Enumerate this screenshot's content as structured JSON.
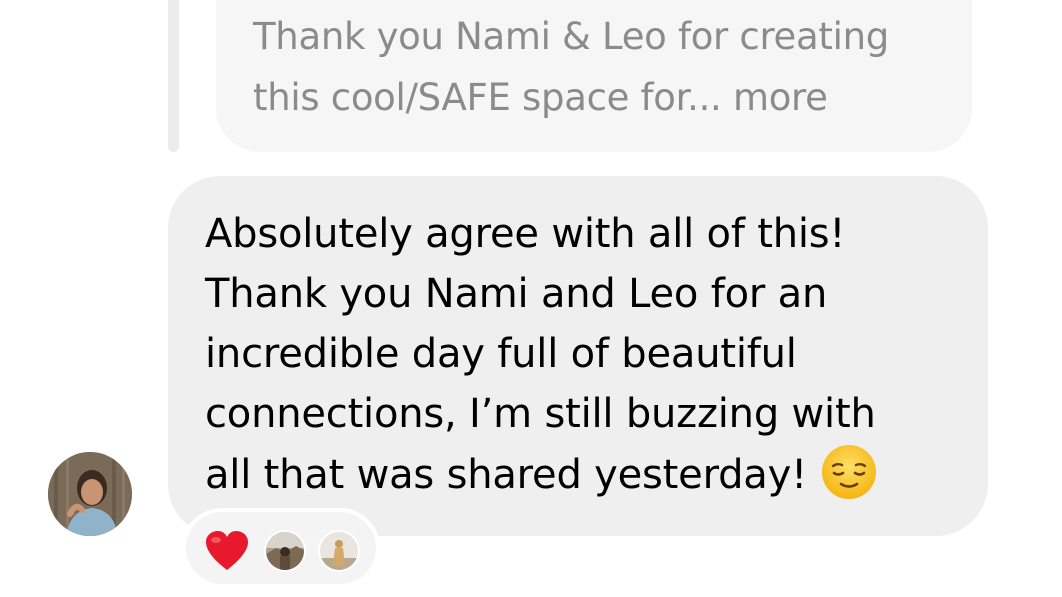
{
  "quoted_message": {
    "lines": [
      "Thank you Nami & Leo for creating",
      "this cool/SAFE space for... more"
    ]
  },
  "message": {
    "lines": [
      "Absolutely agree with all of this!",
      "Thank you Nami and Leo for an",
      "incredible day full of beautiful",
      "connections, I’m still buzzing with",
      "all that was shared yesterday!"
    ],
    "emoji_icon": "relieved-face-emoji"
  },
  "sender": {
    "avatar_icon": "user-avatar-photo"
  },
  "reactions": {
    "emoji": "heart",
    "reactor_icons": [
      "reactor-avatar-1",
      "reactor-avatar-2"
    ]
  },
  "colors": {
    "bubble_bg": "#efefef",
    "quote_bg": "#f6f6f6",
    "quote_text": "#8b8b8b",
    "heart": "#e8192c",
    "emoji_face": "#ffcc33"
  }
}
